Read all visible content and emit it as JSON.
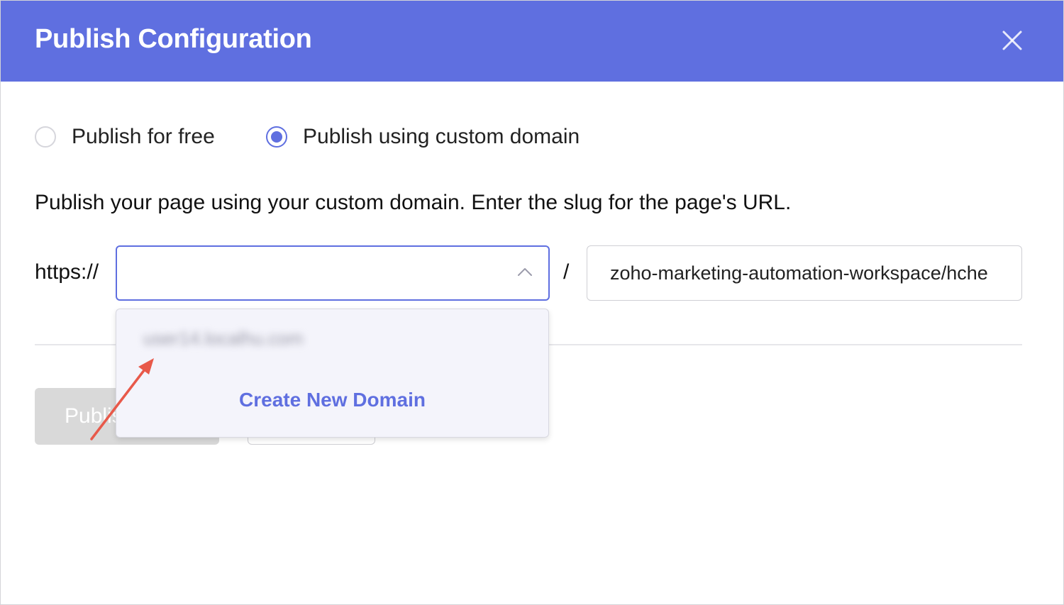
{
  "dialog": {
    "title": "Publish Configuration",
    "close_icon": "close-icon",
    "header_color": "#5f6fe0"
  },
  "publish_options": {
    "free_label": "Publish for free",
    "custom_label": "Publish using custom domain",
    "selected": "custom"
  },
  "description": "Publish your page using your custom domain. Enter the slug for the page's URL.",
  "url": {
    "protocol": "https://",
    "separator": "/",
    "domain_value": "",
    "slug_value": "zoho-marketing-automation-workspace/hche"
  },
  "dropdown": {
    "options": [
      "user14.localhu.com"
    ],
    "create_label": "Create New Domain"
  },
  "buttons": {
    "publish_label": "Publish"
  },
  "annotation": {
    "arrow_color": "#e8594a"
  }
}
